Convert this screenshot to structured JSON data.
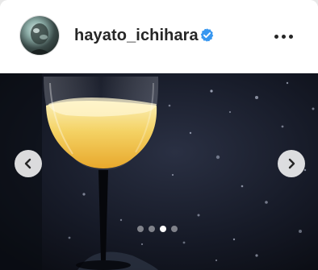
{
  "post": {
    "username": "hayato_ichihara",
    "verified_icon": "verified-badge-icon",
    "more_icon": "more-options-icon",
    "avatar_icon": "profile-avatar",
    "carousel": {
      "prev_icon": "chevron-left-icon",
      "next_icon": "chevron-right-icon",
      "slide_count": 4,
      "active_slide": 3
    }
  },
  "colors": {
    "verified": "#3897f0",
    "text": "#262626",
    "drink": "#f0c24a"
  }
}
